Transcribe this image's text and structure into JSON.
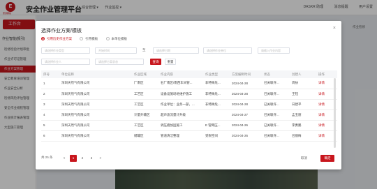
{
  "header": {
    "logo_text": "E",
    "logo_sub": "聚源碳谷",
    "title": "安全作业管理平台",
    "nav": [
      "综合管理 ▾",
      "作业监控 ▾"
    ],
    "right": [
      "DASKR 助理",
      "消息提醒",
      "用户设置"
    ]
  },
  "sidebar": {
    "tab": "工作台",
    "heading": "作业智能(报引)",
    "items": [
      "检修检验计划审批",
      "作业许可证管理",
      "作业方案管理",
      "安全教育培训管理",
      "作业安全分析",
      "检修风险评估管理",
      "安全作业规程管理",
      "作业统计报表管理",
      "大型施工管理"
    ]
  },
  "content": {
    "side_label": "作业检修"
  },
  "modal": {
    "title": "选择作业方案/模板",
    "close": "×",
    "radios": [
      "引用历史作业方案",
      "引用模板",
      "本单位模板"
    ],
    "selected_radio": 0,
    "filters": {
      "work_type": "请选择作业类型",
      "date_start": "开始时间",
      "date_sep": "至",
      "date_end": "请选择日期",
      "unit": "请选择作业单位",
      "content": "请输入作业内容",
      "person": "请选择作业人",
      "scheme": "请选择方案状态"
    },
    "buttons": {
      "query": "查询",
      "reset": "重置",
      "cancel": "取消",
      "ok": "确定"
    },
    "columns": [
      "序号",
      "单位名称",
      "作业区域",
      "作业内容",
      "作业类型",
      "方案编制时间",
      "状态",
      "创建人",
      "操作"
    ],
    "rows": [
      [
        "1",
        "深圳天然气有限公司",
        "厂南区",
        "石厂南区/南西车间管...",
        "非特殊危...",
        "2024-04-28",
        "已关联许...",
        "周扶",
        "详情"
      ],
      [
        "2",
        "深圳天然气有限公司",
        "工艺区",
        "设备设施场地维护施工",
        "非特殊危...",
        "2024-04-28",
        "已关联许...",
        "王钰",
        "详情"
      ],
      [
        "3",
        "深圳天然气有限公司",
        "工艺区",
        "作业单位：业务一部，...",
        "非特殊危...",
        "2024-04-28",
        "已关联许...",
        "日建平",
        "详情"
      ],
      [
        "4",
        "深圳天然气有限公司",
        "计量外输区",
        "超声波流量计升级",
        "",
        "2024-04-27",
        "已关联许...",
        "孟玉丽",
        "详情"
      ],
      [
        "5",
        "深圳天然气有限公司",
        "工艺区",
        "调压撬加固施工",
        "E 管网压...",
        "2024-04-26",
        "已关联许...",
        "李勇鹏",
        "详情"
      ],
      [
        "6",
        "深圳天然气有限公司",
        "储罐区",
        "管道清洁整理",
        "受限空间",
        "2024-04-26",
        "已关联许...",
        "吕丽梅",
        "详情"
      ]
    ],
    "pagination": {
      "total": "共 25 条",
      "prev": "<",
      "pages": [
        "1",
        "2",
        "3"
      ],
      "current": "1",
      "next": ">"
    }
  }
}
